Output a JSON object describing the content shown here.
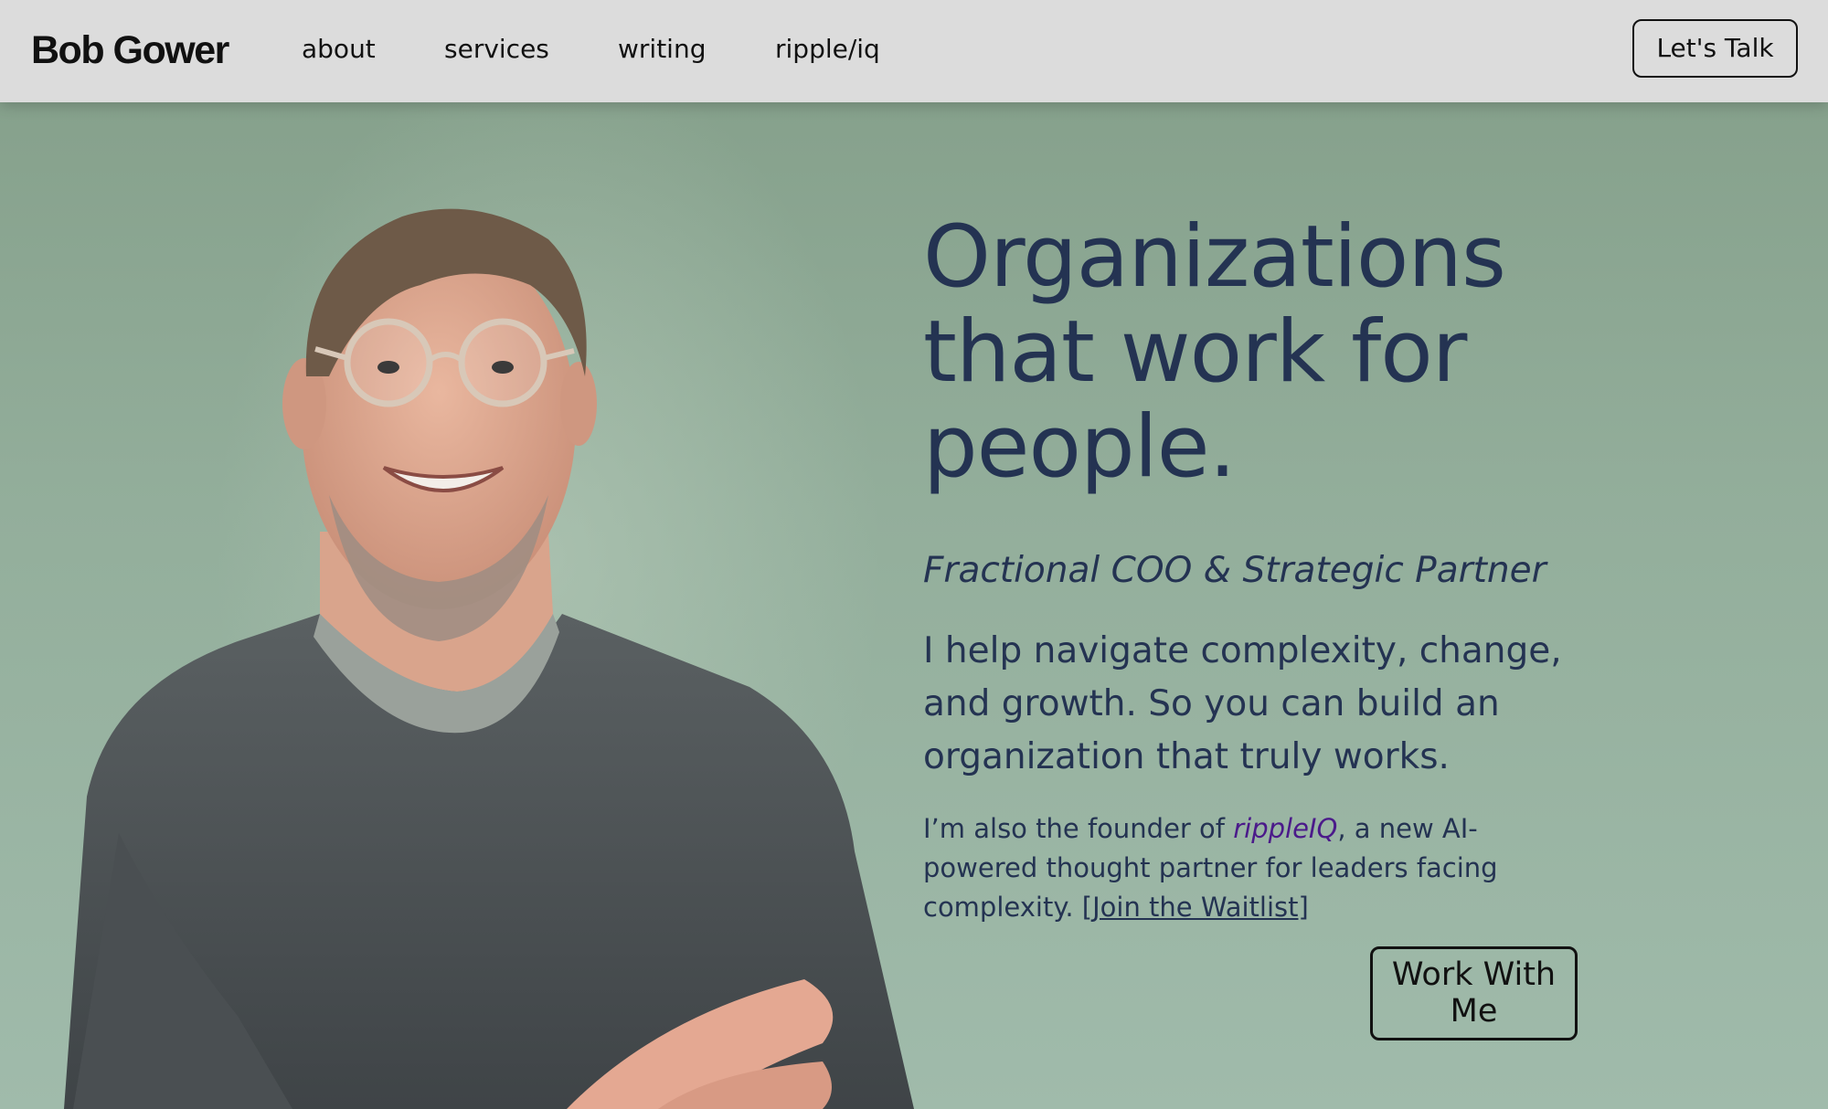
{
  "header": {
    "logo": "Bob Gower",
    "nav": [
      {
        "label": "about"
      },
      {
        "label": "services"
      },
      {
        "label": "writing"
      },
      {
        "label": "ripple/iq"
      }
    ],
    "cta_label": "Let's Talk"
  },
  "hero": {
    "headline_lines": [
      "Organizations",
      "that work for",
      "people."
    ],
    "tagline": "Fractional COO & Strategic Partner",
    "lead": "I help navigate complexity, change, and growth. So you can build an organization that truly works.",
    "sub": {
      "prefix": "I’m also the founder of ",
      "link": "rippleIQ",
      "middle": ", a new AI-powered thought partner for leaders facing complexity. [",
      "waitlist": "Join the Waitlist",
      "suffix": "]"
    },
    "cta_label": "Work With Me"
  },
  "colors": {
    "header_bg": "#dcdcdc",
    "hero_bg": "#93ad9a",
    "text_navy": "#243352",
    "link_purple": "#4b1a8a"
  }
}
